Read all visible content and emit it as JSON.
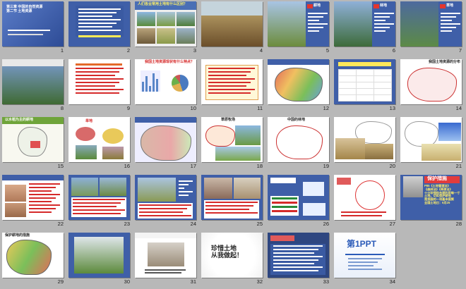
{
  "slides": [
    {
      "num": "1",
      "title": "第三章  中国的自然资源\n第二节  土地资源",
      "kind": "cover"
    },
    {
      "num": "2",
      "kind": "blue-text"
    },
    {
      "num": "3",
      "title": "人们各业常用土地有什么区别？",
      "kind": "photos"
    },
    {
      "num": "4",
      "kind": "field"
    },
    {
      "num": "5",
      "title": "耕地",
      "kind": "photo-label"
    },
    {
      "num": "6",
      "title": "林地",
      "kind": "photo-label"
    },
    {
      "num": "7",
      "title": "草地",
      "kind": "photo-label"
    },
    {
      "num": "8",
      "title": "",
      "kind": "photo-label"
    },
    {
      "num": "9",
      "kind": "text-red"
    },
    {
      "num": "10",
      "title": "我国土地资源现状有什么特点？",
      "kind": "chart"
    },
    {
      "num": "11",
      "kind": "text-orange"
    },
    {
      "num": "12",
      "kind": "map-color"
    },
    {
      "num": "13",
      "kind": "table-blue"
    },
    {
      "num": "14",
      "title": "我国土地资源的分布",
      "kind": "map-outline"
    },
    {
      "num": "15",
      "title": "以水稻为主的耕地",
      "kind": "map-green"
    },
    {
      "num": "16",
      "title": "旱地",
      "kind": "map-diagram"
    },
    {
      "num": "17",
      "kind": "map-red"
    },
    {
      "num": "18",
      "title": "草原牧场",
      "kind": "map-grass"
    },
    {
      "num": "19",
      "title": "中国的林地",
      "kind": "map-outline2"
    },
    {
      "num": "20",
      "kind": "map-desert"
    },
    {
      "num": "21",
      "kind": "map-sky"
    },
    {
      "num": "22",
      "kind": "text-photo"
    },
    {
      "num": "23",
      "kind": "photos-text"
    },
    {
      "num": "24",
      "kind": "photo-text"
    },
    {
      "num": "25",
      "kind": "photo-text2"
    },
    {
      "num": "26",
      "kind": "diagram-blue"
    },
    {
      "num": "27",
      "kind": "diagram-red"
    },
    {
      "num": "28",
      "title": "保护措施",
      "body": "P85《土地管理法》\n《森林法》《草原法》\n十分珍惜和合理利用每一寸土地，切实保护耕地\n是我国的一项基本国策\n全国土地日：6月25",
      "kind": "protect"
    },
    {
      "num": "29",
      "title": "保护耕地的措施",
      "kind": "map-small"
    },
    {
      "num": "30",
      "kind": "field2"
    },
    {
      "num": "31",
      "kind": "footprint"
    },
    {
      "num": "32",
      "title": "珍惜土地\n从我做起！",
      "kind": "slogan"
    },
    {
      "num": "33",
      "kind": "summary"
    },
    {
      "num": "34",
      "title": "第1PPT",
      "kind": "logo"
    }
  ],
  "colors": {
    "blue": "#3f5fa8",
    "darkBlue": "#2a3f80",
    "red": "#d52a2a",
    "green": "#5a8c3a",
    "grass": "#7aa84a",
    "sky": "#6fa0d8"
  }
}
